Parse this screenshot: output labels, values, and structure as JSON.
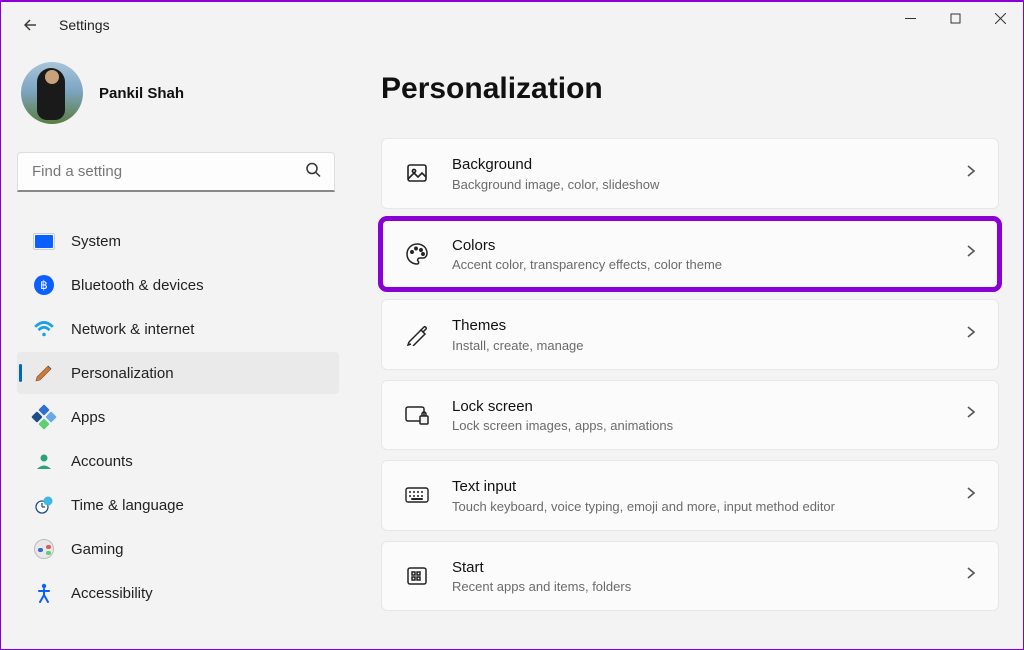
{
  "window": {
    "title": "Settings"
  },
  "user": {
    "name": "Pankil Shah"
  },
  "search": {
    "placeholder": "Find a setting"
  },
  "sidebar": {
    "items": [
      {
        "label": "System"
      },
      {
        "label": "Bluetooth & devices"
      },
      {
        "label": "Network & internet"
      },
      {
        "label": "Personalization"
      },
      {
        "label": "Apps"
      },
      {
        "label": "Accounts"
      },
      {
        "label": "Time & language"
      },
      {
        "label": "Gaming"
      },
      {
        "label": "Accessibility"
      }
    ],
    "selected_index": 3
  },
  "page": {
    "title": "Personalization"
  },
  "cards": [
    {
      "title": "Background",
      "subtitle": "Background image, color, slideshow"
    },
    {
      "title": "Colors",
      "subtitle": "Accent color, transparency effects, color theme",
      "highlight": true
    },
    {
      "title": "Themes",
      "subtitle": "Install, create, manage"
    },
    {
      "title": "Lock screen",
      "subtitle": "Lock screen images, apps, animations"
    },
    {
      "title": "Text input",
      "subtitle": "Touch keyboard, voice typing, emoji and more, input method editor"
    },
    {
      "title": "Start",
      "subtitle": "Recent apps and items, folders"
    }
  ],
  "highlight_color": "#8a00d4"
}
